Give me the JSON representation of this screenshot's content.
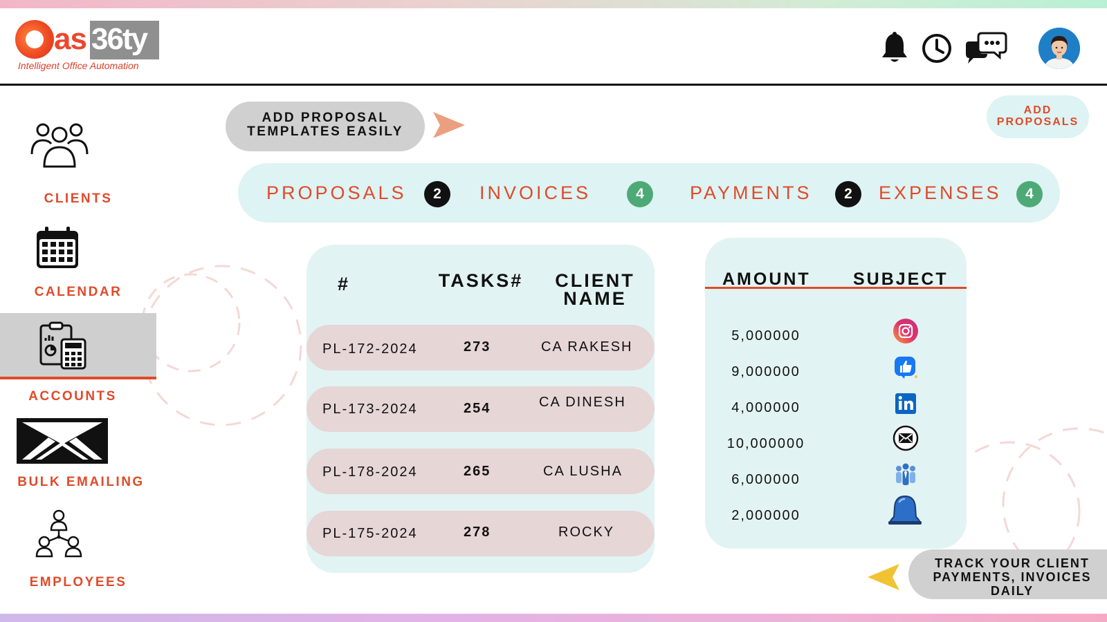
{
  "brand": {
    "logo_as": "as",
    "logo_num": "36ty",
    "tagline": "Intelligent Office Automation"
  },
  "header": {
    "icons": [
      "bell-icon",
      "clock-icon",
      "chat-icon",
      "avatar"
    ]
  },
  "sidebar": {
    "items": [
      {
        "label": "CLIENTS",
        "icon": "clients-icon"
      },
      {
        "label": "CALENDAR",
        "icon": "calendar-icon"
      },
      {
        "label": "ACCOUNTS",
        "icon": "accounts-icon",
        "active": true
      },
      {
        "label": "BULK EMAILING",
        "icon": "envelope-icon"
      },
      {
        "label": "EMPLOYEES",
        "icon": "employees-icon"
      }
    ]
  },
  "callouts": {
    "templates": {
      "line1": "ADD PROPOSAL",
      "line2": "TEMPLATES EASILY"
    },
    "add_proposals": {
      "line1": "ADD",
      "line2": "PROPOSALS"
    },
    "track": {
      "line1": "TRACK YOUR CLIENT",
      "line2": "PAYMENTS, INVOICES",
      "line3": "DAILY"
    }
  },
  "tabs": [
    {
      "label": "PROPOSALS",
      "count": "2"
    },
    {
      "label": "INVOICES",
      "count": "4"
    },
    {
      "label": "PAYMENTS",
      "count": "2"
    },
    {
      "label": "EXPENSES",
      "count": "4"
    }
  ],
  "tasks_table": {
    "headers": {
      "id": "#",
      "tasks": "TASKS#",
      "client_l1": "CLIENT",
      "client_l2": "NAME"
    },
    "rows": [
      {
        "id": "PL-172-2024",
        "tasks": "273",
        "client": "CA RAKESH"
      },
      {
        "id": "PL-173-2024",
        "tasks": "254",
        "client": "CA DINESH"
      },
      {
        "id": "PL-178-2024",
        "tasks": "265",
        "client": "CA LUSHA"
      },
      {
        "id": "PL-175-2024",
        "tasks": "278",
        "client": "ROCKY"
      }
    ]
  },
  "amounts_table": {
    "headers": {
      "amount": "AMOUNT",
      "subject": "SUBJECT"
    },
    "rows": [
      {
        "amount": "5,000000",
        "subject_icon": "instagram-icon"
      },
      {
        "amount": "9,000000",
        "subject_icon": "like-icon"
      },
      {
        "amount": "4,000000",
        "subject_icon": "linkedin-icon"
      },
      {
        "amount": "10,000000",
        "subject_icon": "mail-icon"
      },
      {
        "amount": "6,000000",
        "subject_icon": "team-icon"
      },
      {
        "amount": "2,000000",
        "subject_icon": "notification-bell-icon"
      }
    ]
  },
  "colors": {
    "accent": "#e04a2a",
    "panel": "#e2f3f3",
    "row": "#e6d6d6",
    "badge_dark": "#111111",
    "badge_green": "#4daa76"
  }
}
